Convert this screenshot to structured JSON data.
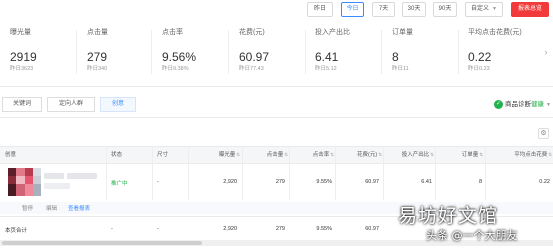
{
  "date_buttons": [
    "昨日",
    "今日",
    "7天",
    "30天",
    "90天",
    "自定义"
  ],
  "active_date": "今日",
  "export_label": "报表总览",
  "metrics": [
    {
      "label": "曝光量",
      "value": "2919",
      "prev": "昨日3623"
    },
    {
      "label": "点击量",
      "value": "279",
      "prev": "昨日340"
    },
    {
      "label": "点击率",
      "value": "9.56%",
      "prev": "昨日9.38%"
    },
    {
      "label": "花费(元)",
      "value": "60.97",
      "prev": "昨日77.43"
    },
    {
      "label": "投入产出比",
      "value": "6.41",
      "prev": "昨日5.12"
    },
    {
      "label": "订单量",
      "value": "8",
      "prev": "昨日11"
    },
    {
      "label": "平均点击花费(元)",
      "value": "0.22",
      "prev": "昨日0.23"
    }
  ],
  "tabs": [
    "关键词",
    "定向人群",
    "创意"
  ],
  "active_tab": "创意",
  "diagnosis": {
    "label": "商品诊断",
    "status": "健康",
    "icon": "check-circle-icon"
  },
  "table": {
    "headers": [
      "创意",
      "状态",
      "尺寸",
      "曝光量",
      "点击量",
      "点击率",
      "花费(元)",
      "投入产出比",
      "订单量",
      "平均点击花费"
    ],
    "row": {
      "status": "推广中",
      "size": "-",
      "impressions": "2,920",
      "clicks": "279",
      "ctr": "9.55%",
      "cost": "60.97",
      "roi": "6.41",
      "orders": "8",
      "cpc": "0.22"
    },
    "row_actions": [
      "暂停",
      "编辑",
      "查看报表"
    ],
    "total": {
      "label": "本页合计",
      "status": "-",
      "size": "-",
      "impressions": "2,920",
      "clicks": "279",
      "ctr": "9.55%",
      "cost": "60.97"
    }
  },
  "watermark": {
    "line1": "易坊好文馆",
    "line2": "头条 @一个大朋友"
  },
  "colors": {
    "accent": "#3b8cff",
    "red": "#f23a3a",
    "green": "#22b14c"
  }
}
